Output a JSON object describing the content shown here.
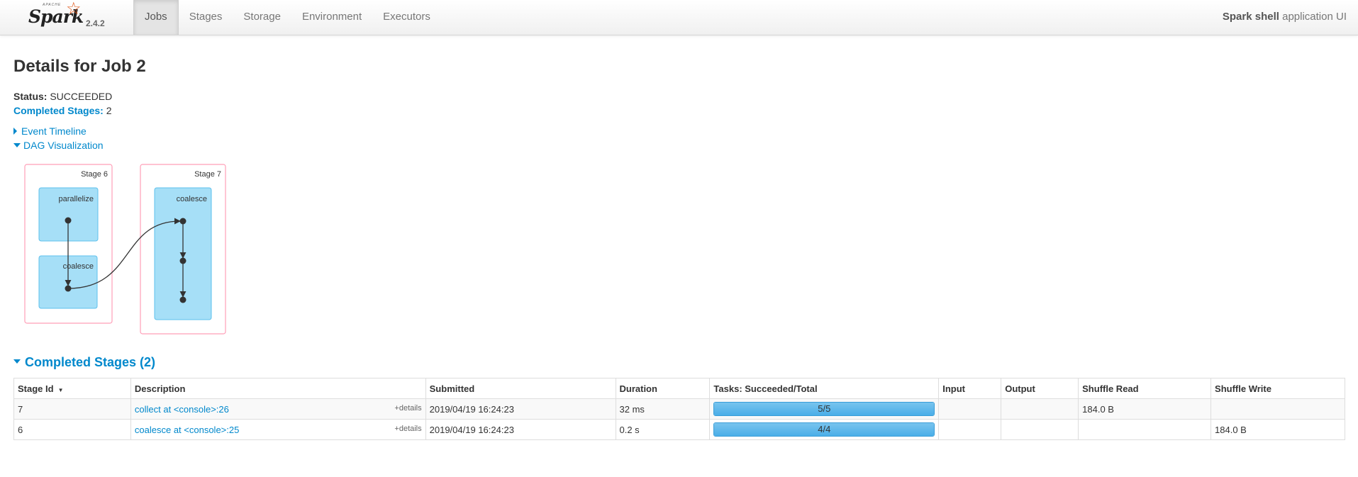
{
  "brand": {
    "apache": "APACHE",
    "logo": "Spark",
    "version": "2.4.2"
  },
  "nav": {
    "tabs": [
      "Jobs",
      "Stages",
      "Storage",
      "Environment",
      "Executors"
    ],
    "active": "Jobs"
  },
  "app": {
    "name": "Spark shell",
    "suffix": " application UI"
  },
  "page": {
    "title": "Details for Job 2",
    "status_label": "Status:",
    "status_value": "SUCCEEDED",
    "completed_label": "Completed Stages:",
    "completed_value": "2",
    "event_timeline": "Event Timeline",
    "dag_visualization": "DAG Visualization"
  },
  "dag": {
    "stages": [
      {
        "label": "Stage 6",
        "nodes": [
          "parallelize",
          "coalesce"
        ]
      },
      {
        "label": "Stage 7",
        "nodes": [
          "coalesce"
        ]
      }
    ]
  },
  "completed_stages": {
    "title": "Completed Stages (2)",
    "columns": [
      "Stage Id",
      "Description",
      "Submitted",
      "Duration",
      "Tasks: Succeeded/Total",
      "Input",
      "Output",
      "Shuffle Read",
      "Shuffle Write"
    ],
    "details_label": "+details",
    "rows": [
      {
        "id": "7",
        "description": "collect at <console>:26",
        "submitted": "2019/04/19 16:24:23",
        "duration": "32 ms",
        "tasks": "5/5",
        "progress": 1.0,
        "input": "",
        "output": "",
        "shuffle_read": "184.0 B",
        "shuffle_write": ""
      },
      {
        "id": "6",
        "description": "coalesce at <console>:25",
        "submitted": "2019/04/19 16:24:23",
        "duration": "0.2 s",
        "tasks": "4/4",
        "progress": 1.0,
        "input": "",
        "output": "",
        "shuffle_read": "",
        "shuffle_write": "184.0 B"
      }
    ]
  },
  "colors": {
    "link": "#0088cc",
    "stage_border": "#ff9fb8",
    "node_fill": "#a6dff7",
    "node_border": "#5ec0ec"
  }
}
